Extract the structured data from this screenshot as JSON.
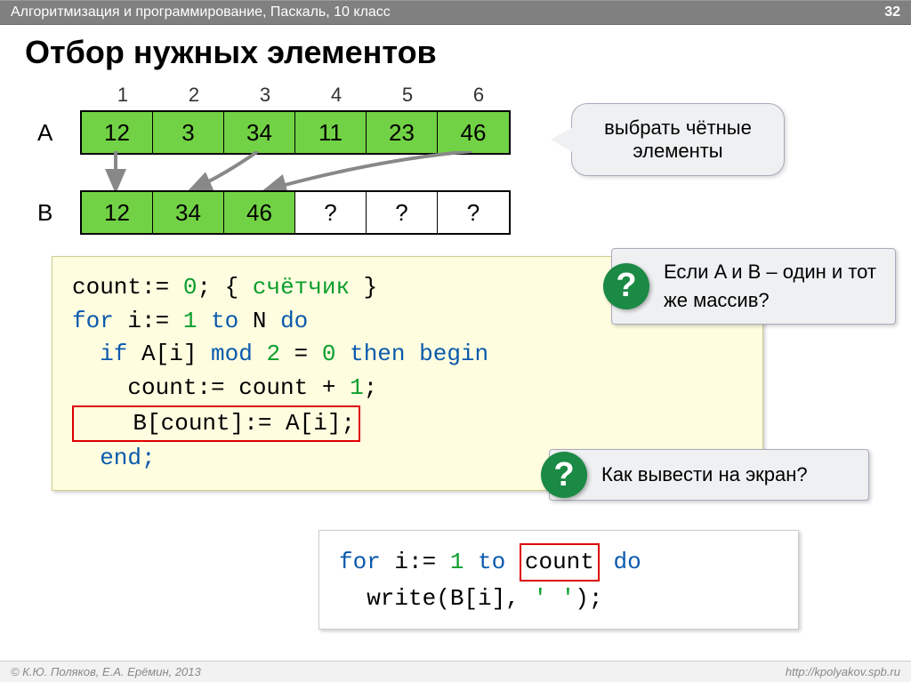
{
  "header": {
    "breadcrumb": "Алгоритмизация и программирование, Паскаль, 10 класс",
    "page": "32"
  },
  "title": "Отбор нужных элементов",
  "arrays": {
    "labelA": "A",
    "labelB": "B",
    "indices": [
      "1",
      "2",
      "3",
      "4",
      "5",
      "6"
    ],
    "A": [
      "12",
      "3",
      "34",
      "11",
      "23",
      "46"
    ],
    "B": [
      "12",
      "34",
      "46",
      "?",
      "?",
      "?"
    ]
  },
  "callout1": "выбрать чётные элементы",
  "code": {
    "l1_a": "count:= ",
    "l1_n": "0",
    "l1_b": "; { ",
    "l1_c": "счётчик",
    "l1_d": " }",
    "l2_a": "for",
    "l2_b": " i:= ",
    "l2_n": "1",
    "l2_c": " to",
    "l2_d": " N ",
    "l2_e": "do",
    "l3_a": "  if",
    "l3_b": " A[i] ",
    "l3_c": "mod",
    "l3_d": " ",
    "l3_n": "2",
    "l3_e": " = ",
    "l3_n2": "0",
    "l3_f": " then begin",
    "l4": "    count:= count + ",
    "l4_n": "1",
    "l4_b": ";",
    "l5": "    B[count]:= A[i];",
    "l6": "  end;"
  },
  "q1": "Если A и B – один и тот же массив?",
  "q2": "Как вывести на экран?",
  "code2": {
    "l1_a": "for",
    "l1_b": " i:= ",
    "l1_n": "1",
    "l1_c": " to ",
    "l1_box": "count",
    "l1_d": " do",
    "l2_a": "  write(B[i], ",
    "l2_s": "' '",
    "l2_b": ");"
  },
  "footer": {
    "left": "© К.Ю. Поляков, Е.А. Ерёмин, 2013",
    "right": "http://kpolyakov.spb.ru"
  },
  "qmark": "?"
}
